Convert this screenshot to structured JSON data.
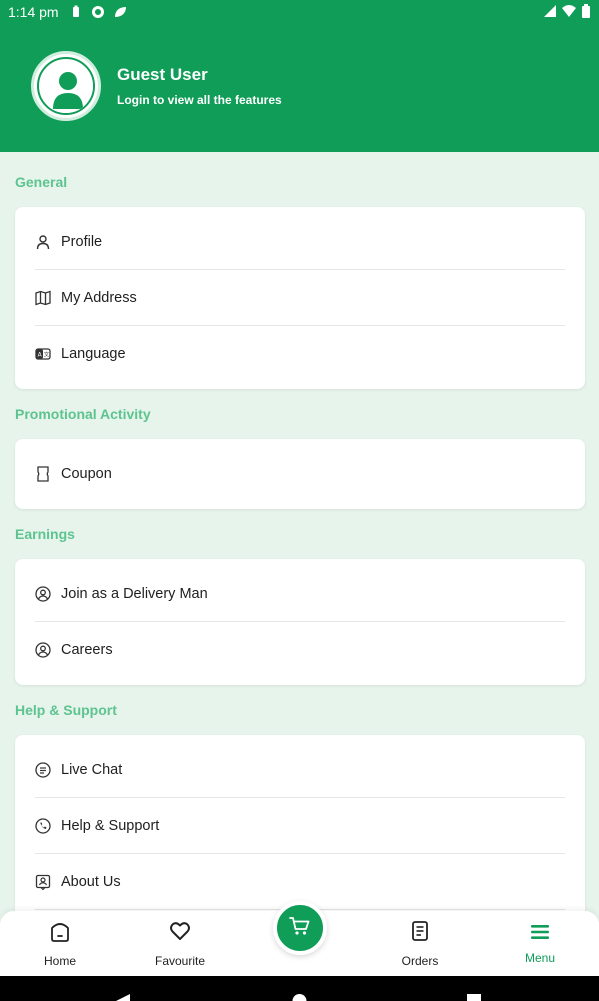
{
  "status_bar": {
    "time": "1:14 pm"
  },
  "header": {
    "user_name": "Guest User",
    "subtitle": "Login to view all the features"
  },
  "sections": {
    "general": {
      "title": "General",
      "items": [
        "Profile",
        "My Address",
        "Language"
      ]
    },
    "promotional": {
      "title": "Promotional Activity",
      "items": [
        "Coupon"
      ]
    },
    "earnings": {
      "title": "Earnings",
      "items": [
        "Join as a Delivery Man",
        "Careers"
      ]
    },
    "help": {
      "title": "Help & Support",
      "items": [
        "Live Chat",
        "Help & Support",
        "About Us"
      ]
    }
  },
  "bottom_nav": {
    "home": "Home",
    "favourite": "Favourite",
    "orders": "Orders",
    "menu": "Menu"
  },
  "colors": {
    "primary": "#0f9d58",
    "section_title": "#5ec48f",
    "background": "#e6f4ec"
  },
  "icons": {
    "profile": "person-icon",
    "address": "map-icon",
    "language": "language-icon",
    "coupon": "coupon-icon",
    "delivery": "user-circle-icon",
    "careers": "user-circle-icon",
    "chat": "chat-icon",
    "help": "phone-icon",
    "about": "about-icon",
    "home": "home-icon",
    "favourite": "heart-icon",
    "cart": "cart-icon",
    "orders": "orders-icon",
    "menu": "menu-icon"
  }
}
